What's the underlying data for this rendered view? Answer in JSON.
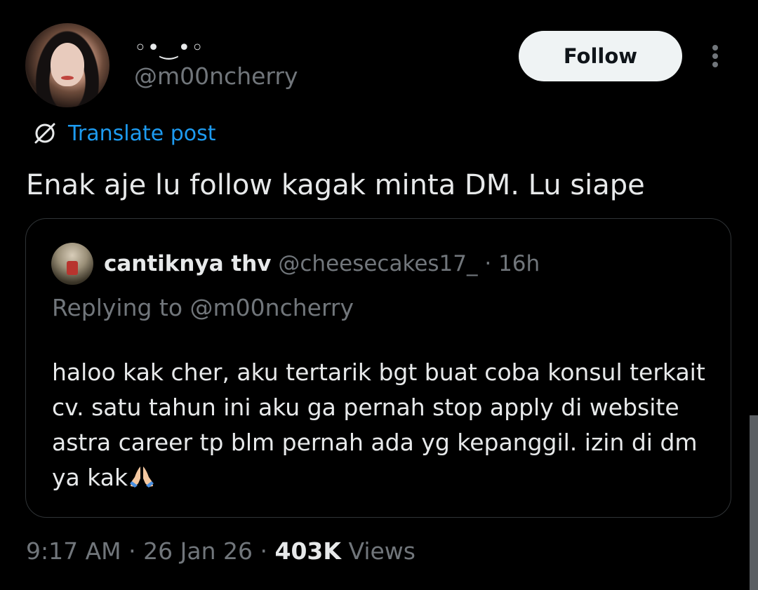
{
  "author": {
    "display_name": "◦•‿•◦",
    "handle": "@m00ncherry"
  },
  "header": {
    "follow_label": "Follow",
    "more_icon": "more-vertical-icon"
  },
  "translate": {
    "label": "Translate post",
    "icon": "globe-slash-icon"
  },
  "post": {
    "text": "Enak aje lu follow kagak minta DM. Lu siape"
  },
  "quote": {
    "name": "cantiknya thv",
    "handle": "@cheesecakes17_",
    "separator": "·",
    "time": "16h",
    "replying_to": "Replying to @m00ncherry",
    "text": "haloo kak cher, aku tertarik bgt buat coba konsul terkait cv. satu tahun ini aku ga pernah stop apply di website astra career tp blm pernah ada yg kepanggil. izin di dm ya kak",
    "emoji": "folded-hands-icon"
  },
  "meta": {
    "time": "9:17 AM",
    "sep1": "·",
    "date": "26 Jan 26",
    "sep2": "·",
    "views_count": "403K",
    "views_label": "Views"
  },
  "colors": {
    "background": "#000000",
    "text_primary": "#e7e9ea",
    "text_secondary": "#71767b",
    "link": "#1d9bf0",
    "border": "#2f3336",
    "button_bg": "#eff3f4"
  }
}
